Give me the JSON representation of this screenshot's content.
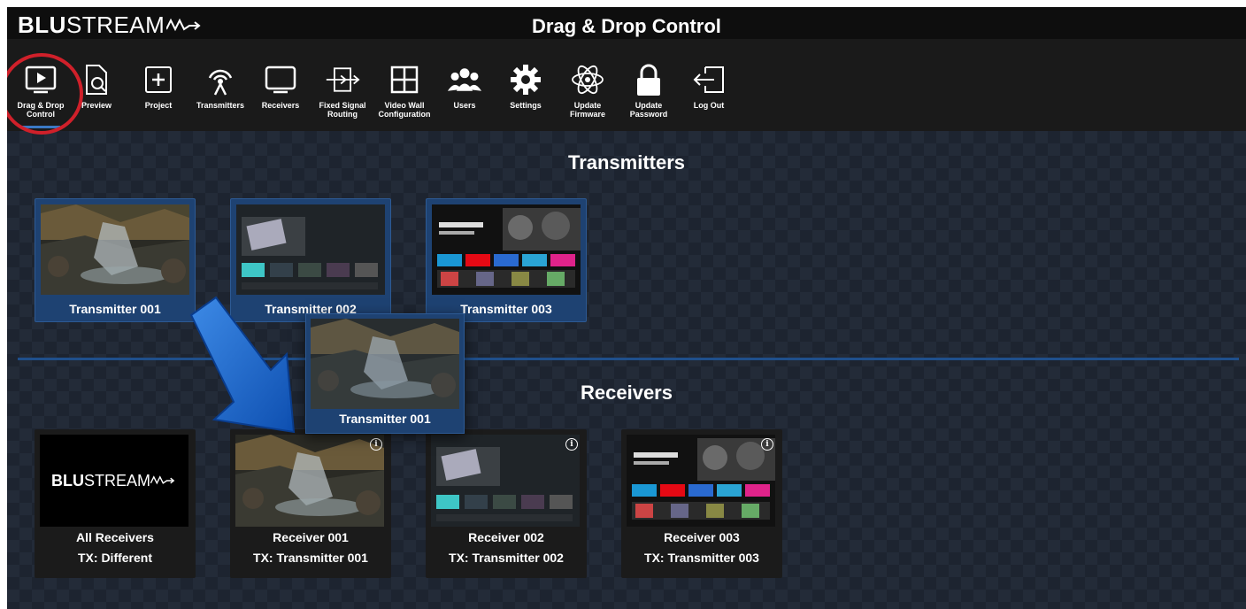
{
  "header": {
    "brand_bold": "BLU",
    "brand_light": "STREAM",
    "title": "Drag & Drop Control"
  },
  "toolbar": {
    "items": [
      {
        "label": "Drag & Drop\nControl",
        "icon": "play-screen-icon",
        "active": true
      },
      {
        "label": "Preview",
        "icon": "document-search-icon"
      },
      {
        "label": "Project",
        "icon": "plus-box-icon"
      },
      {
        "label": "Transmitters",
        "icon": "broadcast-antenna-icon"
      },
      {
        "label": "Receivers",
        "icon": "monitor-icon"
      },
      {
        "label": "Fixed Signal\nRouting",
        "icon": "routing-arrow-icon"
      },
      {
        "label": "Video Wall\nConfiguration",
        "icon": "grid-icon"
      },
      {
        "label": "Users",
        "icon": "users-icon"
      },
      {
        "label": "Settings",
        "icon": "gear-icon"
      },
      {
        "label": "Update\nFirmware",
        "icon": "atom-icon"
      },
      {
        "label": "Update\nPassword",
        "icon": "lock-icon"
      },
      {
        "label": "Log Out",
        "icon": "logout-icon"
      }
    ]
  },
  "transmitters": {
    "title": "Transmitters",
    "cards": [
      {
        "name": "Transmitter 001",
        "thumbnail": "waterfall"
      },
      {
        "name": "Transmitter 002",
        "thumbnail": "tv-home-menu"
      },
      {
        "name": "Transmitter 003",
        "thumbnail": "streaming-home"
      }
    ]
  },
  "receivers": {
    "title": "Receivers",
    "cards": [
      {
        "name": "All Receivers",
        "tx": "TX: Different",
        "thumbnail": "blustream-logo"
      },
      {
        "name": "Receiver 001",
        "tx": "TX: Transmitter 001",
        "thumbnail": "waterfall"
      },
      {
        "name": "Receiver 002",
        "tx": "TX: Transmitter 002",
        "thumbnail": "tv-home-menu"
      },
      {
        "name": "Receiver 003",
        "tx": "TX: Transmitter 003",
        "thumbnail": "streaming-home"
      }
    ]
  },
  "dragging": {
    "name": "Transmitter 001",
    "thumbnail": "waterfall"
  },
  "colors": {
    "accent": "#3b79c4",
    "card_blue": "#1e4272",
    "highlight": "#d0202a",
    "arrow": "#1f6fd0"
  }
}
